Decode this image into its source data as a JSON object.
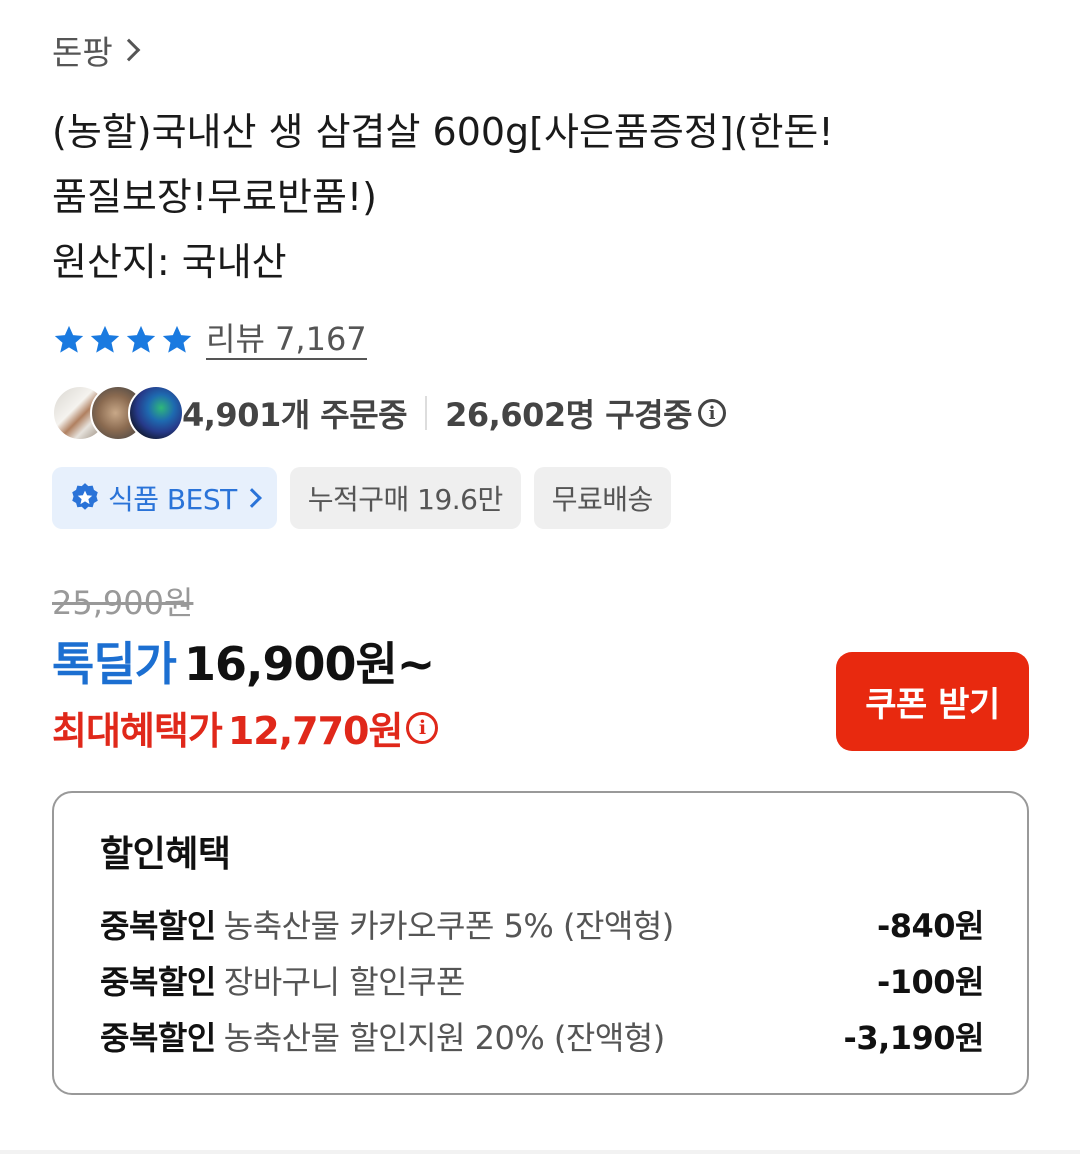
{
  "seller": {
    "name": "돈팡"
  },
  "product": {
    "title_line1": "(농할)국내산 생 삼겹살 600g[사은품증정](한돈!",
    "title_line2": "품질보장!무료반품!)",
    "title_line3": "원산지: 국내산"
  },
  "rating": {
    "stars": 4,
    "review_label": "리뷰 7,167"
  },
  "social": {
    "orders": "4,901개 주문중",
    "viewers": "26,602명 구경중"
  },
  "badges": {
    "best": "식품 BEST",
    "cumulative": "누적구매 19.6만",
    "shipping": "무료배송"
  },
  "price": {
    "original": "25,900원",
    "deal_label": "톡딜가",
    "deal_price": "16,900원~",
    "max_label": "최대혜택가",
    "max_price": "12,770원",
    "coupon_button": "쿠폰 받기"
  },
  "discount": {
    "title": "할인혜택",
    "rows": [
      {
        "tag": "중복할인",
        "desc": "농축산물 카카오쿠폰 5% (잔액형)",
        "amount": "-840원"
      },
      {
        "tag": "중복할인",
        "desc": "장바구니 할인쿠폰",
        "amount": "-100원"
      },
      {
        "tag": "중복할인",
        "desc": "농축산물 할인지원 20% (잔액형)",
        "amount": "-3,190원"
      }
    ]
  },
  "colors": {
    "accent_blue": "#1c6fd1",
    "accent_red": "#e0281a",
    "coupon_red": "#e8290f",
    "star_blue": "#1a7ae0"
  }
}
